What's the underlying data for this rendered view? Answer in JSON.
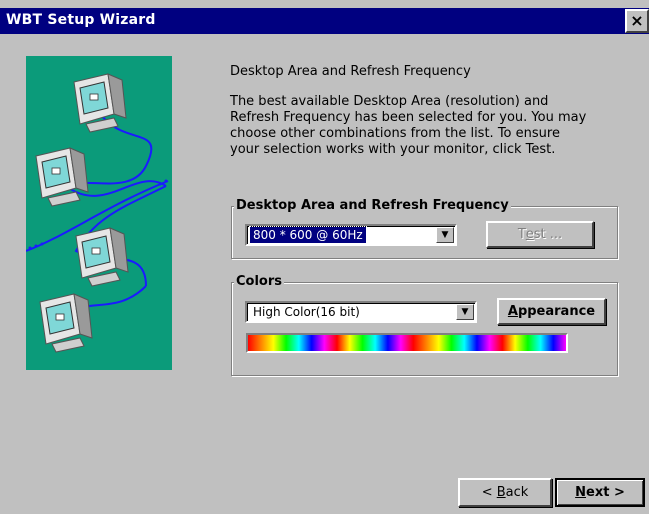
{
  "window": {
    "title": "WBT Setup Wizard",
    "close_label": "×"
  },
  "content": {
    "heading": "Desktop Area and Refresh Frequency",
    "description": "The best available Desktop Area (resolution) and\nRefresh Frequency has been selected for you.  You may\nchoose other combinations from the list.  To ensure\nyour selection works with your monitor, click Test."
  },
  "desktop_group": {
    "label": "Desktop Area and Refresh Frequency",
    "selected_value": "800 * 600 @ 60Hz",
    "test_button_pre": "T",
    "test_button_acc": "e",
    "test_button_post": "st ..."
  },
  "colors_group": {
    "label": "Colors",
    "selected_value": "High Color(16 bit)",
    "appearance_acc": "A",
    "appearance_rest": "ppearance"
  },
  "nav": {
    "back_pre": "< ",
    "back_acc": "B",
    "back_post": "ack",
    "next_acc": "N",
    "next_post": "ext >"
  },
  "icons": {
    "close": "close-icon",
    "dropdown": "chevron-down-icon",
    "illustration": "networked-monitors-illustration"
  }
}
